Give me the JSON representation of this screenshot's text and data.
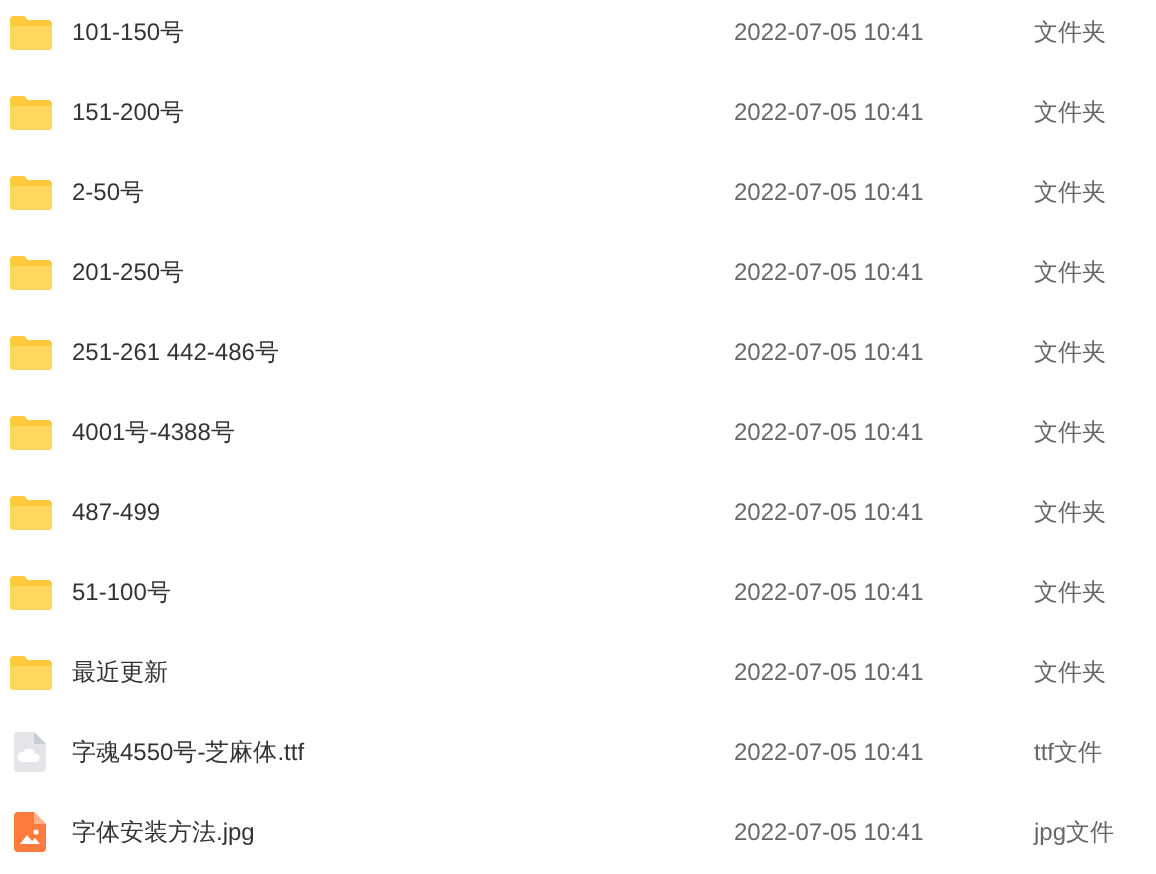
{
  "files": [
    {
      "kind": "folder",
      "name": "101-150号",
      "modified": "2022-07-05 10:41",
      "type": "文件夹"
    },
    {
      "kind": "folder",
      "name": "151-200号",
      "modified": "2022-07-05 10:41",
      "type": "文件夹"
    },
    {
      "kind": "folder",
      "name": "2-50号",
      "modified": "2022-07-05 10:41",
      "type": "文件夹"
    },
    {
      "kind": "folder",
      "name": "201-250号",
      "modified": "2022-07-05 10:41",
      "type": "文件夹"
    },
    {
      "kind": "folder",
      "name": "251-261 442-486号",
      "modified": "2022-07-05 10:41",
      "type": "文件夹"
    },
    {
      "kind": "folder",
      "name": "4001号-4388号",
      "modified": "2022-07-05 10:41",
      "type": "文件夹"
    },
    {
      "kind": "folder",
      "name": "487-499",
      "modified": "2022-07-05 10:41",
      "type": "文件夹"
    },
    {
      "kind": "folder",
      "name": "51-100号",
      "modified": "2022-07-05 10:41",
      "type": "文件夹"
    },
    {
      "kind": "folder",
      "name": "最近更新",
      "modified": "2022-07-05 10:41",
      "type": "文件夹"
    },
    {
      "kind": "font",
      "name": "字魂4550号-芝麻体.ttf",
      "modified": "2022-07-05 10:41",
      "type": "ttf文件"
    },
    {
      "kind": "image",
      "name": "字体安装方法.jpg",
      "modified": "2022-07-05 10:41",
      "type": "jpg文件"
    }
  ]
}
